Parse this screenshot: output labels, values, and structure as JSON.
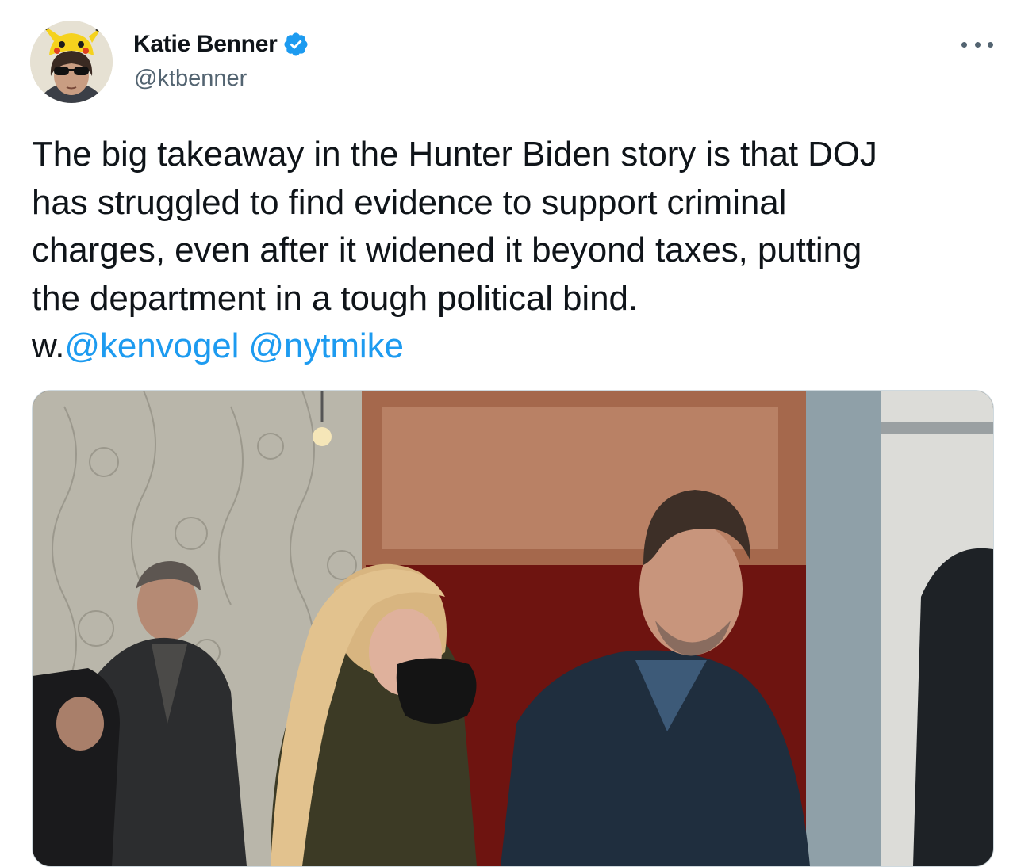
{
  "tweet": {
    "author": {
      "display_name": "Katie Benner",
      "handle": "@ktbenner",
      "verified": true,
      "avatar_icon": "pikachu-hat-avatar"
    },
    "text_lines": [
      "The big takeaway in the Hunter Biden story is that DOJ",
      "has struggled to find evidence to support criminal",
      "charges, even after it widened it beyond taxes, putting",
      "the department in a tough political bind."
    ],
    "last_line_prefix": "w.",
    "mentions": [
      "@kenvogel",
      "@nytmike"
    ],
    "more_icon": "more-horizontal-icon",
    "media": {
      "kind": "photo",
      "description_icon": "tweet-photo"
    }
  },
  "colors": {
    "text": "#0f1419",
    "secondary": "#536471",
    "link": "#1d9bf0",
    "verified": "#1d9bf0",
    "border": "#cfd9de"
  }
}
